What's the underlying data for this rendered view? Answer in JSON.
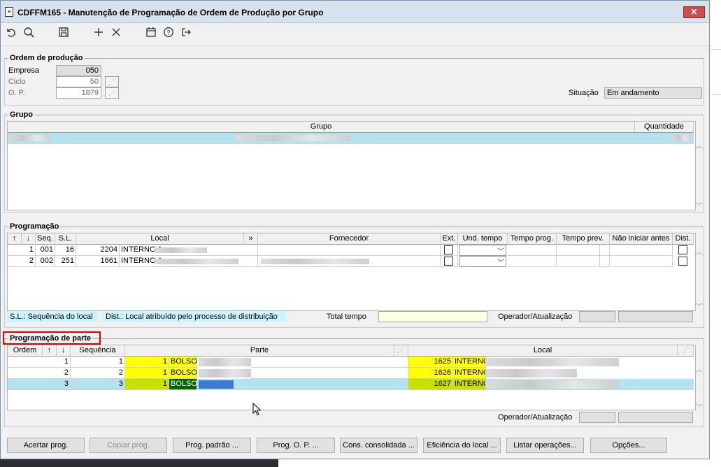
{
  "window": {
    "title": "CDFFM165 - Manutenção de Programação de Ordem de Produção por Grupo",
    "close_label": "✕"
  },
  "toolbar": {
    "icons": [
      "undo-icon",
      "search-icon",
      "save-icon",
      "add-icon",
      "delete-icon",
      "calendar-icon",
      "help-icon",
      "exit-icon"
    ]
  },
  "ordem": {
    "legend": "Ordem de produção",
    "empresa_label": "Empresa",
    "empresa_value": "050",
    "ciclo_label": "Ciclo",
    "ciclo_value": "50",
    "op_label": "O. P.",
    "op_value": "1879",
    "situacao_label": "Situação",
    "situacao_value": "Em andamento"
  },
  "grupo": {
    "legend": "Grupo",
    "headers": [
      "Grupo",
      "Quantidade"
    ]
  },
  "programacao": {
    "legend": "Programação",
    "headers": [
      "↑",
      "↓",
      "Seq.",
      "S.L.",
      "Local",
      "»",
      "Fornecedor",
      "Ext.",
      "Und. tempo",
      "Tempo prog.",
      "Tempo prev.",
      "Não iniciar antes",
      "Dist."
    ],
    "rows": [
      {
        "n": "1",
        "seq": "001",
        "sl": "16",
        "local_code": "2204",
        "local_name": "INTERNO A"
      },
      {
        "n": "2",
        "seq": "002",
        "sl": "251",
        "local_code": "1661",
        "local_name": "INTERNO A"
      }
    ],
    "note_sl": "S.L.: Sequência do local",
    "note_dist": "Dist.: Local atribuído pelo processo de distribuição",
    "total_tempo_label": "Total tempo",
    "operador_label": "Operador/Atualização"
  },
  "parte": {
    "legend": "Programação de parte",
    "headers": [
      "Ordem",
      "↑",
      "↓",
      "Sequência",
      "Parte",
      "Local"
    ],
    "rows": [
      {
        "ordem": "1",
        "seq": "1",
        "parte_num": "1",
        "parte_name": "BOLSO",
        "local_code": "1625",
        "local_name": "INTERNO"
      },
      {
        "ordem": "2",
        "seq": "2",
        "parte_num": "1",
        "parte_name": "BOLSO",
        "local_code": "1626",
        "local_name": "INTERNO"
      },
      {
        "ordem": "3",
        "seq": "3",
        "parte_num": "1",
        "parte_name": "BOLSO",
        "local_code": "1627",
        "local_name": "INTERNO"
      }
    ],
    "operador_label": "Operador/Atualização"
  },
  "buttons": {
    "acertar": "Acertar prog.",
    "copiar": "Copiar prog.",
    "padrao": "Prog. padrão ...",
    "prog_op": "Prog. O. P. ...",
    "consolidada": "Cons. consolidada ...",
    "eficiencia": "Eficiência do local ...",
    "listar": "Listar operações...",
    "opcoes": "Opções..."
  },
  "colors": {
    "selected_row": "#b4e2ee",
    "highlight_yellow": "#ffff00",
    "highlight_red_box": "#e00000"
  }
}
